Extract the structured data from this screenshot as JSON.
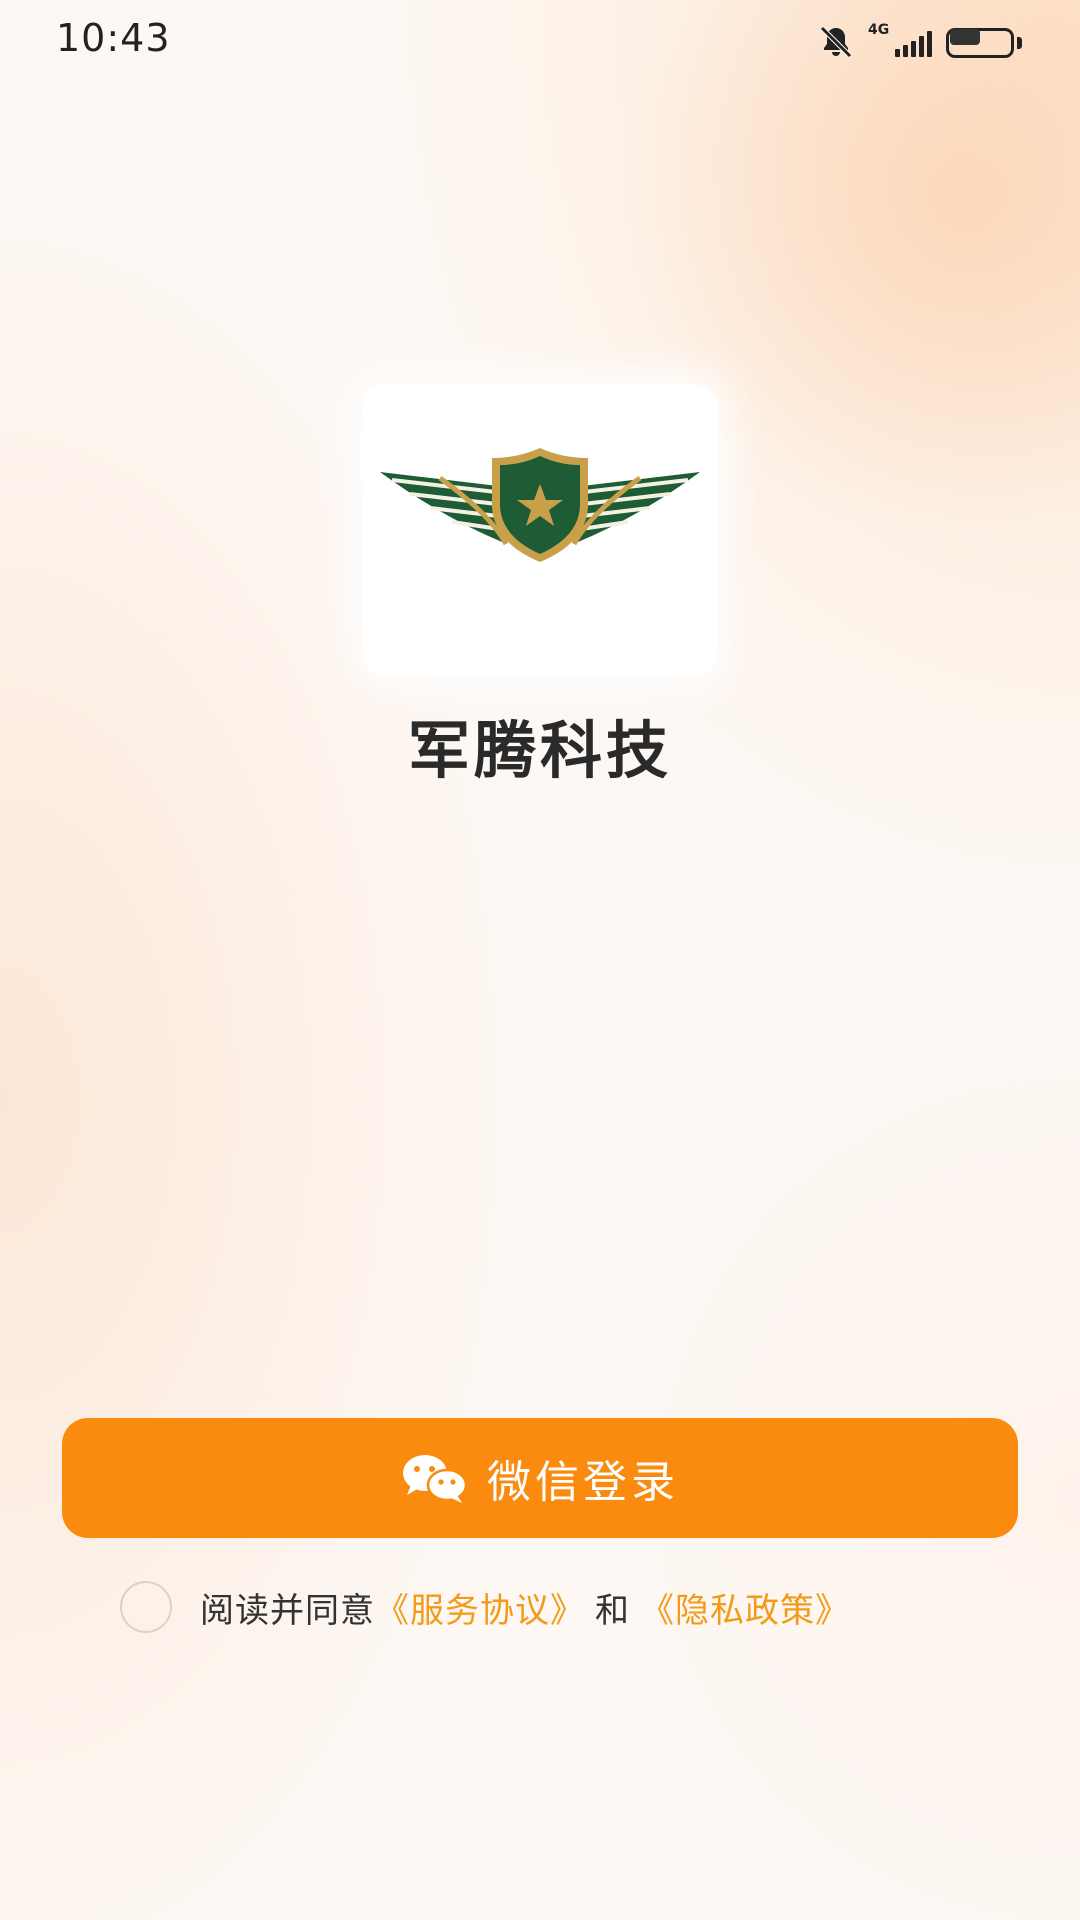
{
  "status_bar": {
    "time": "10:43",
    "network_label": "4G",
    "battery_level": 0.55
  },
  "app": {
    "name": "军腾科技",
    "logo_icon": "winged-shield-star-logo",
    "logo_colors": {
      "green": "#1d5c35",
      "gold": "#c9a04a"
    }
  },
  "login": {
    "button_label": "微信登录",
    "button_icon": "wechat-icon",
    "button_color": "#fa8b0f"
  },
  "agreement": {
    "checked": false,
    "prefix": "阅读并同意",
    "service_link": "《服务协议》",
    "conjunction": "和",
    "privacy_link": "《隐私政策》",
    "link_color": "#f39a18"
  }
}
